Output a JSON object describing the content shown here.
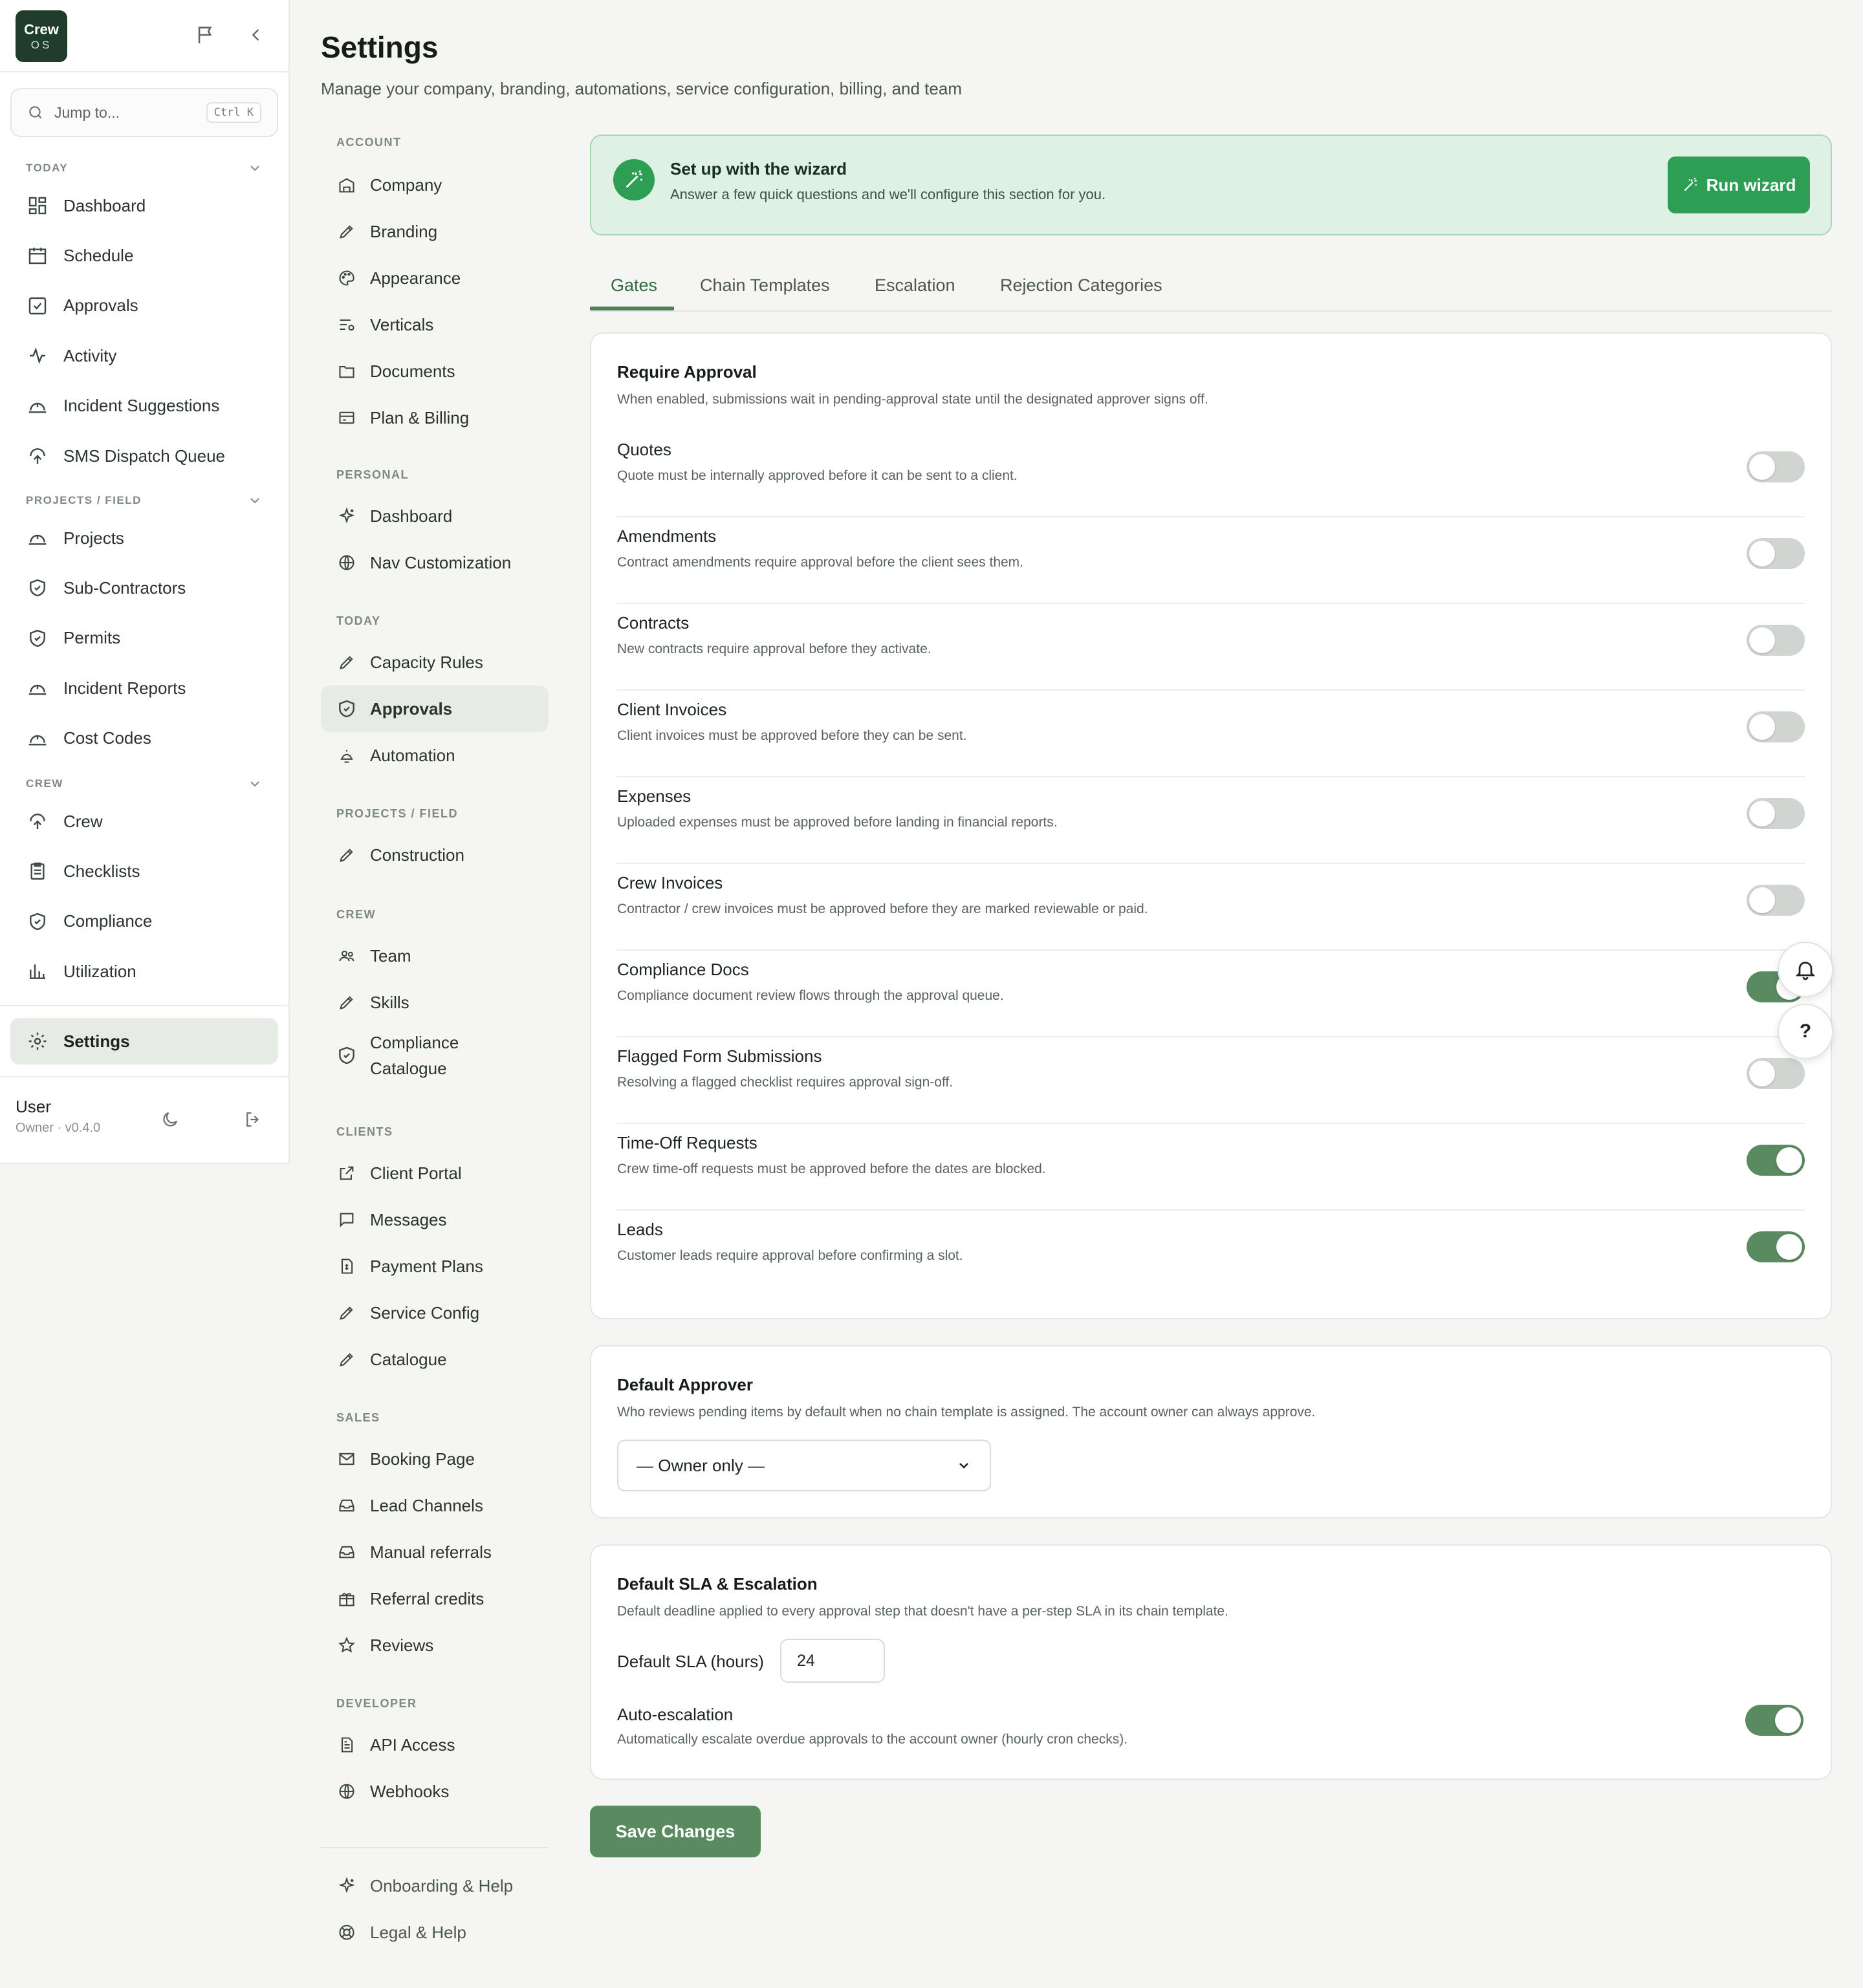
{
  "app": {
    "logo_line1": "Crew",
    "logo_line2": "OS"
  },
  "sidebar": {
    "search_placeholder": "Jump to...",
    "search_shortcut": "Ctrl K",
    "sections": {
      "today": "TODAY",
      "projects": "PROJECTS / FIELD",
      "crew": "CREW"
    },
    "today_items": [
      {
        "label": "Dashboard",
        "icon": "dashboard-icon"
      },
      {
        "label": "Schedule",
        "icon": "calendar-icon"
      },
      {
        "label": "Approvals",
        "icon": "check-square-icon"
      },
      {
        "label": "Activity",
        "icon": "activity-icon"
      },
      {
        "label": "Incident Suggestions",
        "icon": "hardhat-icon"
      },
      {
        "label": "SMS Dispatch Queue",
        "icon": "crew-icon"
      }
    ],
    "projects_items": [
      {
        "label": "Projects",
        "icon": "hardhat-icon"
      },
      {
        "label": "Sub-Contractors",
        "icon": "shield-icon"
      },
      {
        "label": "Permits",
        "icon": "shield-icon"
      },
      {
        "label": "Incident Reports",
        "icon": "hardhat-icon"
      },
      {
        "label": "Cost Codes",
        "icon": "hardhat-icon"
      }
    ],
    "crew_items": [
      {
        "label": "Crew",
        "icon": "crew-icon"
      },
      {
        "label": "Checklists",
        "icon": "clipboard-icon"
      },
      {
        "label": "Compliance",
        "icon": "shield-icon"
      },
      {
        "label": "Utilization",
        "icon": "bar-chart-icon"
      }
    ],
    "settings_label": "Settings",
    "user": {
      "name": "User",
      "role": "Owner · v0.4.0"
    }
  },
  "page": {
    "title": "Settings",
    "subtitle": "Manage your company, branding, automations, service configuration, billing, and team"
  },
  "settings_nav": {
    "account_label": "ACCOUNT",
    "account": [
      "Company",
      "Branding",
      "Appearance",
      "Verticals",
      "Documents",
      "Plan & Billing"
    ],
    "personal_label": "PERSONAL",
    "personal": [
      "Dashboard",
      "Nav Customization"
    ],
    "today_label": "TODAY",
    "today": [
      "Capacity Rules",
      "Approvals",
      "Automation"
    ],
    "projects_label": "PROJECTS / FIELD",
    "projects": [
      "Construction"
    ],
    "crew_label": "CREW",
    "crew": [
      "Team",
      "Skills",
      "Compliance Catalogue"
    ],
    "clients_label": "CLIENTS",
    "clients": [
      "Client Portal",
      "Messages",
      "Payment Plans",
      "Service Config",
      "Catalogue"
    ],
    "sales_label": "SALES",
    "sales": [
      "Booking Page",
      "Lead Channels",
      "Manual referrals",
      "Referral credits",
      "Reviews"
    ],
    "developer_label": "DEVELOPER",
    "developer": [
      "API Access",
      "Webhooks"
    ],
    "footer": [
      "Onboarding & Help",
      "Legal & Help"
    ]
  },
  "wizard": {
    "title": "Set up with the wizard",
    "description": "Answer a few quick questions and we'll configure this section for you.",
    "button": "Run wizard"
  },
  "tabs": [
    "Gates",
    "Chain Templates",
    "Escalation",
    "Rejection Categories"
  ],
  "gates": {
    "title": "Require Approval",
    "description": "When enabled, submissions wait in pending-approval state until the designated approver signs off.",
    "items": [
      {
        "label": "Quotes",
        "desc": "Quote must be internally approved before it can be sent to a client.",
        "on": false
      },
      {
        "label": "Amendments",
        "desc": "Contract amendments require approval before the client sees them.",
        "on": false
      },
      {
        "label": "Contracts",
        "desc": "New contracts require approval before they activate.",
        "on": false
      },
      {
        "label": "Client Invoices",
        "desc": "Client invoices must be approved before they can be sent.",
        "on": false
      },
      {
        "label": "Expenses",
        "desc": "Uploaded expenses must be approved before landing in financial reports.",
        "on": false
      },
      {
        "label": "Crew Invoices",
        "desc": "Contractor / crew invoices must be approved before they are marked reviewable or paid.",
        "on": false
      },
      {
        "label": "Compliance Docs",
        "desc": "Compliance document review flows through the approval queue.",
        "on": true
      },
      {
        "label": "Flagged Form Submissions",
        "desc": "Resolving a flagged checklist requires approval sign-off.",
        "on": false
      },
      {
        "label": "Time-Off Requests",
        "desc": "Crew time-off requests must be approved before the dates are blocked.",
        "on": true
      },
      {
        "label": "Leads",
        "desc": "Customer leads require approval before confirming a slot.",
        "on": true
      }
    ]
  },
  "default_approver": {
    "title": "Default Approver",
    "description": "Who reviews pending items by default when no chain template is assigned. The account owner can always approve.",
    "selected": "— Owner only —"
  },
  "sla": {
    "title": "Default SLA & Escalation",
    "description": "Default deadline applied to every approval step that doesn't have a per-step SLA in its chain template.",
    "sla_label": "Default SLA (hours)",
    "sla_value": "24",
    "auto_label": "Auto-escalation",
    "auto_desc": "Automatically escalate overdue approvals to the account owner (hourly cron checks).",
    "auto_on": true
  },
  "save_label": "Save Changes",
  "help_label": "?"
}
